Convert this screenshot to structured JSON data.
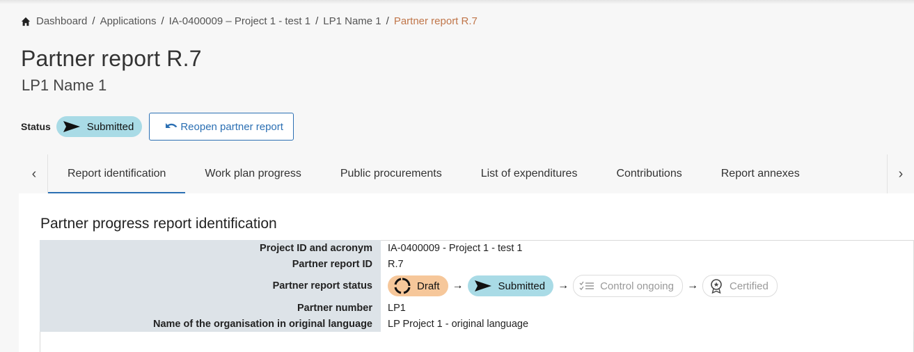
{
  "breadcrumb": {
    "items": [
      "Dashboard",
      "Applications",
      "IA-0400009 – Project 1 - test 1",
      "LP1 Name 1"
    ],
    "current": "Partner report R.7",
    "separator": "/"
  },
  "header": {
    "title": "Partner report R.7",
    "subtitle": "LP1 Name 1"
  },
  "status": {
    "label": "Status",
    "value": "Submitted",
    "reopen_button": "Reopen partner report"
  },
  "tabs": [
    {
      "label": "Report identification",
      "active": true
    },
    {
      "label": "Work plan progress",
      "active": false
    },
    {
      "label": "Public procurements",
      "active": false
    },
    {
      "label": "List of expenditures",
      "active": false
    },
    {
      "label": "Contributions",
      "active": false
    },
    {
      "label": "Report annexes",
      "active": false
    }
  ],
  "section": {
    "title": "Partner progress report identification",
    "rows": [
      {
        "key": "Project ID and acronym",
        "value": "IA-0400009 - Project 1 - test 1"
      },
      {
        "key": "Partner report ID",
        "value": "R.7"
      },
      {
        "key": "Partner report status",
        "value": ""
      },
      {
        "key": "Partner number",
        "value": "LP1"
      },
      {
        "key": "Name of the organisation in original language",
        "value": "LP Project 1 - original language"
      }
    ],
    "status_flow": [
      {
        "label": "Draft",
        "icon": "draft-icon",
        "state": "done"
      },
      {
        "label": "Submitted",
        "icon": "send-icon",
        "state": "current"
      },
      {
        "label": "Control ongoing",
        "icon": "checklist-icon",
        "state": "pending"
      },
      {
        "label": "Certified",
        "icon": "award-icon",
        "state": "pending"
      }
    ],
    "flow_arrow": "→"
  },
  "colors": {
    "accent": "#2b6fb3",
    "breadcrumb_current": "#c0764a",
    "submitted_chip": "#a9dbe6",
    "draft_chip": "#f6c79a",
    "key_cell_bg": "#dde3e8"
  }
}
